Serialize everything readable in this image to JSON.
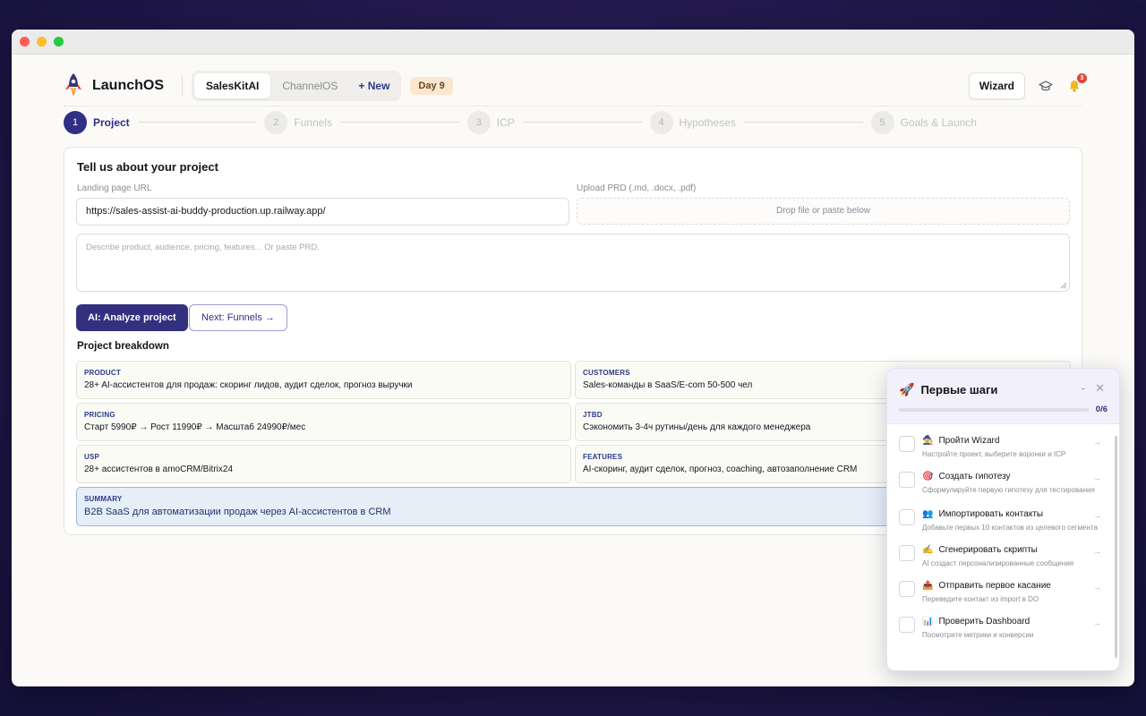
{
  "app": {
    "name": "LaunchOS"
  },
  "tabs": [
    {
      "label": "SalesKitAI",
      "active": true
    },
    {
      "label": "ChannelOS",
      "active": false
    },
    {
      "label": "+ New",
      "active": false
    }
  ],
  "day_badge": "Day 9",
  "header": {
    "wizard_label": "Wizard",
    "notifications_count": "3"
  },
  "steps": [
    {
      "num": "1",
      "label": "Project",
      "active": true
    },
    {
      "num": "2",
      "label": "Funnels",
      "active": false
    },
    {
      "num": "3",
      "label": "ICP",
      "active": false
    },
    {
      "num": "4",
      "label": "Hypotheses",
      "active": false
    },
    {
      "num": "5",
      "label": "Goals & Launch",
      "active": false
    }
  ],
  "project": {
    "title": "Tell us about your project",
    "url_label": "Landing page URL",
    "url_value": "https://sales-assist-ai-buddy-production.up.railway.app/",
    "upload_label": "Upload PRD (.md, .docx, .pdf)",
    "upload_placeholder": "Drop file or paste below",
    "description_placeholder": "Describe product, audience, pricing, features... Or paste PRD.",
    "analyze_label": "AI: Analyze project",
    "next_label": "Next: Funnels →",
    "breakdown_title": "Project breakdown",
    "breakdown": {
      "product": {
        "label": "PRODUCT",
        "value": "28+ AI-ассистентов для продаж: скоринг лидов, аудит сделок, прогноз выручки"
      },
      "customers": {
        "label": "CUSTOMERS",
        "value": "Sales-команды в SaaS/E-com 50-500 чел"
      },
      "pricing": {
        "label": "PRICING",
        "value": "Старт 5990₽ → Рост 11990₽ → Масштаб 24990₽/мес"
      },
      "jtbd": {
        "label": "JTBD",
        "value": "Сэкономить 3-4ч рутины/день для каждого менеджера"
      },
      "usp": {
        "label": "USP",
        "value": "28+ ассистентов в amoCRM/Bitrix24"
      },
      "features": {
        "label": "FEATURES",
        "value": "AI-скоринг, аудит сделок, прогноз, coaching, автозаполнение CRM"
      },
      "summary": {
        "label": "SUMMARY",
        "value": "B2B SaaS для автоматизации продаж через AI-ассистентов в CRM"
      }
    }
  },
  "first_steps": {
    "title": "Первые шаги",
    "progress_text": "0/6",
    "progress_fraction": 0,
    "minimize": "-",
    "close": "✕",
    "tasks": [
      {
        "emoji": "🧙",
        "title": "Пройти Wizard",
        "desc": "Настройте проект, выберите воронки и ICP"
      },
      {
        "emoji": "🎯",
        "title": "Создать гипотезу",
        "desc": "Сформулируйте первую гипотезу для тестирования"
      },
      {
        "emoji": "👥",
        "title": "Импортировать контакты",
        "desc": "Добавьте первых 10 контактов из целевого сегмента"
      },
      {
        "emoji": "✍️",
        "title": "Сгенерировать скрипты",
        "desc": "AI создаст персонализированные сообщения"
      },
      {
        "emoji": "📤",
        "title": "Отправить первое касание",
        "desc": "Переведите контакт из import в DO"
      },
      {
        "emoji": "📊",
        "title": "Проверить Dashboard",
        "desc": "Посмотрите метрики и конверсии"
      }
    ],
    "arrow": "→"
  },
  "colors": {
    "accent": "#32307f",
    "badge": "#fbe6cf",
    "summary_bg": "#e6eef8"
  }
}
